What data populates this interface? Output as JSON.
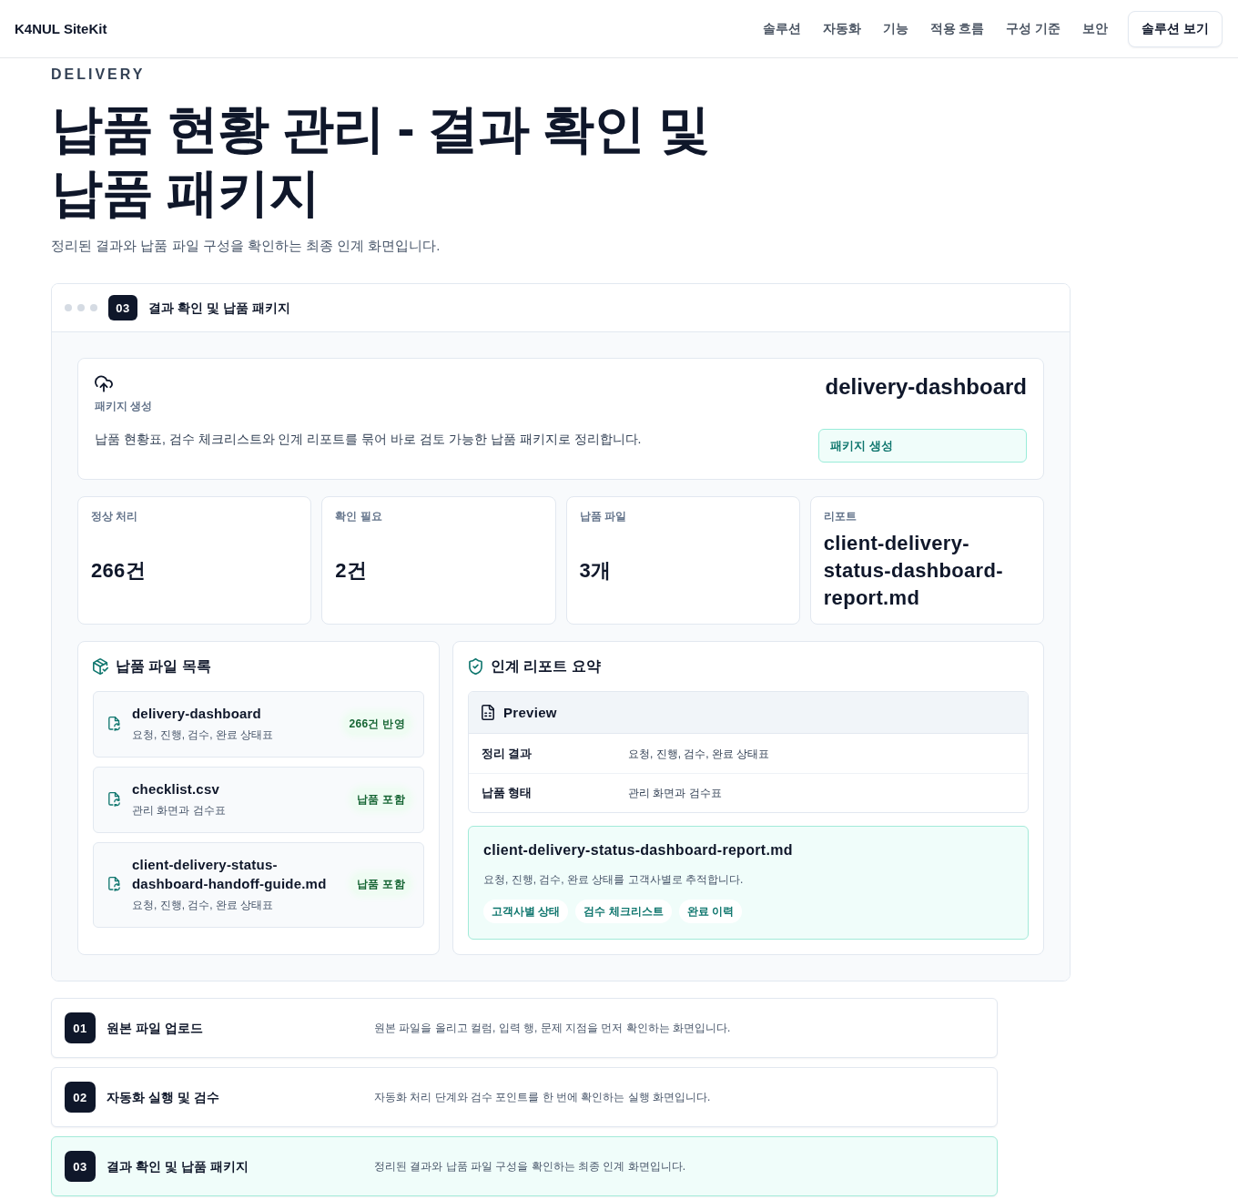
{
  "nav": {
    "logo": "K4NUL SiteKit",
    "links": [
      "솔루션",
      "자동화",
      "기능",
      "적용 흐름",
      "구성 기준",
      "보안"
    ],
    "cta": "솔루션 보기"
  },
  "hero": {
    "eyebrow": "DELIVERY",
    "title": "납품 현황 관리 - 결과 확인 및 납품 패키지",
    "subtitle": "정리된 결과와 납품 파일 구성을 확인하는 최종 인계 화면입니다."
  },
  "panel": {
    "step": "03",
    "title": "결과 확인 및 납품 패키지",
    "summary": {
      "label": "패키지 생성",
      "description": "납품 현황표, 검수 체크리스트와 인계 리포트를 묶어 바로 검토 가능한 납품 패키지로 정리합니다.",
      "name": "delivery-dashboard",
      "status": "패키지 생성"
    },
    "stats": [
      {
        "label": "정상 처리",
        "value": "266건"
      },
      {
        "label": "확인 필요",
        "value": "2건"
      },
      {
        "label": "납품 파일",
        "value": "3개"
      },
      {
        "label": "리포트",
        "value": "client-delivery-status-dashboard-report.md"
      }
    ],
    "files": {
      "title": "납품 파일 목록",
      "items": [
        {
          "name": "delivery-dashboard",
          "description": "요청, 진행, 검수, 완료 상태표",
          "badge": "266건 반영"
        },
        {
          "name": "checklist.csv",
          "description": "관리 화면과 검수표",
          "badge": "납품 포함"
        },
        {
          "name": "client-delivery-status-dashboard-handoff-guide.md",
          "description": "요청, 진행, 검수, 완료 상태표",
          "badge": "납품 포함"
        }
      ]
    },
    "report": {
      "title": "인계 리포트 요약",
      "preview": {
        "title": "Preview",
        "rows": [
          {
            "label": "정리 결과",
            "value": "요청, 진행, 검수, 완료 상태표"
          },
          {
            "label": "납품 형태",
            "value": "관리 화면과 검수표"
          }
        ]
      },
      "file": {
        "name": "client-delivery-status-dashboard-report.md",
        "description": "요청, 진행, 검수, 완료 상태를 고객사별로 추적합니다.",
        "tags": [
          "고객사별 상태",
          "검수 체크리스트",
          "완료 이력"
        ]
      }
    }
  },
  "steps": [
    {
      "number": "01",
      "title": "원본 파일 업로드",
      "description": "원본 파일을 올리고 컬럼, 입력 행, 문제 지점을 먼저 확인하는 화면입니다.",
      "selected": false
    },
    {
      "number": "02",
      "title": "자동화 실행 및 검수",
      "description": "자동화 처리 단계와 검수 포인트를 한 번에 확인하는 실행 화면입니다.",
      "selected": false
    },
    {
      "number": "03",
      "title": "결과 확인 및 납품 패키지",
      "description": "정리된 결과와 납품 파일 구성을 확인하는 최종 인계 화면입니다.",
      "selected": true
    }
  ]
}
